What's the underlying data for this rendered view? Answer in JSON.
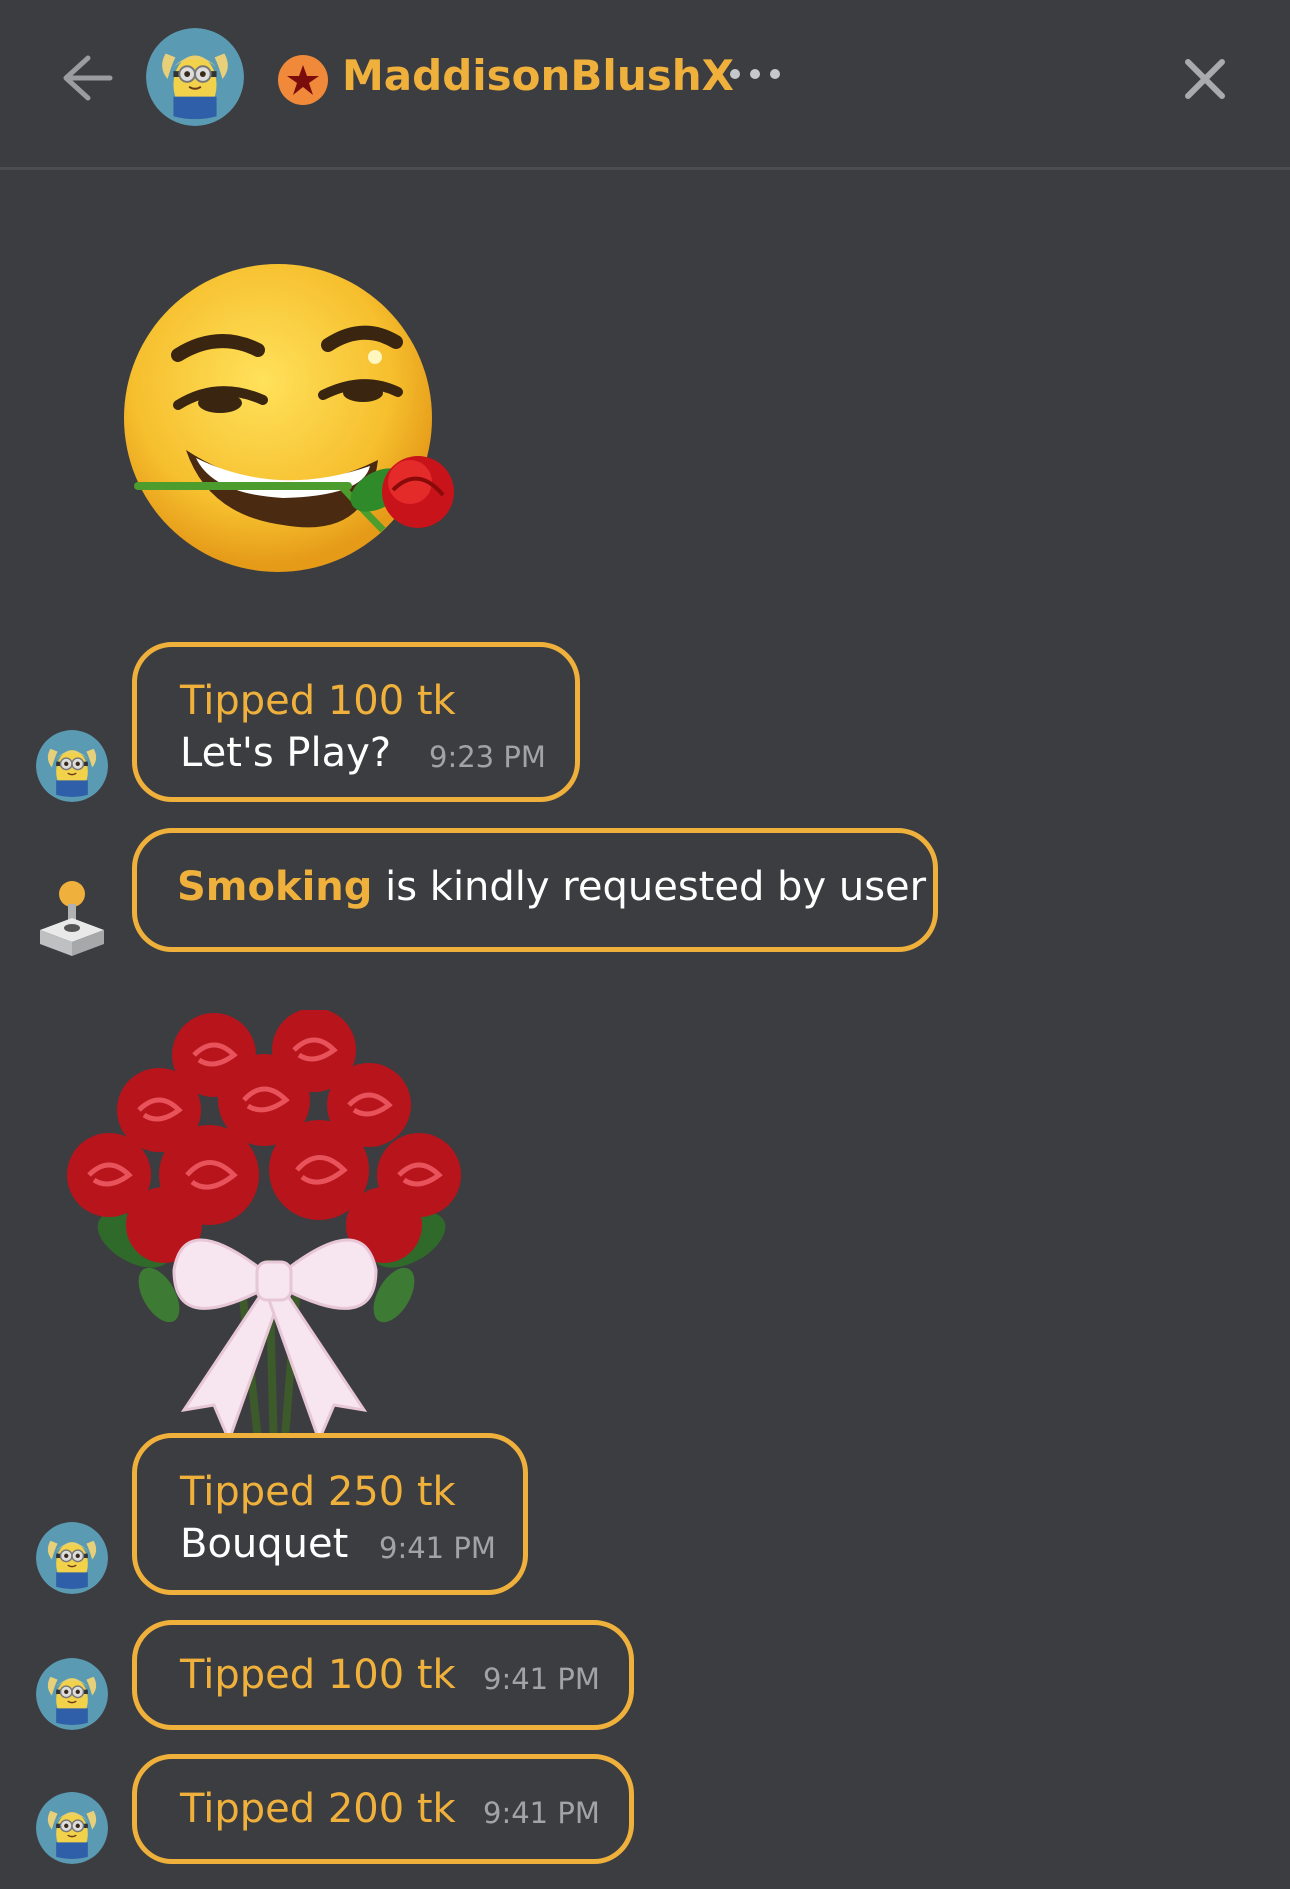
{
  "header": {
    "username": "MaddisonBlushX",
    "back_icon": "arrow-left-icon",
    "more_icon": "ellipsis-icon",
    "close_icon": "close-icon",
    "badge_icon": "star-badge-icon"
  },
  "messages": [
    {
      "type": "sticker",
      "sticker": "smirking-face-with-rose-emoji"
    },
    {
      "type": "tip",
      "tip": "Tipped 100 tk",
      "message": "Let's Play?",
      "time": "9:23 PM"
    },
    {
      "type": "system",
      "highlight": "Smoking",
      "text": " is kindly requested by user",
      "icon": "joystick-icon"
    },
    {
      "type": "sticker",
      "sticker": "rose-bouquet"
    },
    {
      "type": "tip",
      "tip": "Tipped 250 tk",
      "message": "Bouquet",
      "time": "9:41 PM"
    },
    {
      "type": "tip",
      "tip": "Tipped 100 tk",
      "time": "9:41 PM"
    },
    {
      "type": "tip",
      "tip": "Tipped 200 tk",
      "time": "9:41 PM"
    }
  ],
  "colors": {
    "background": "#3c3d40",
    "accent": "#f0b13c",
    "timestamp": "#a2a3a6"
  }
}
